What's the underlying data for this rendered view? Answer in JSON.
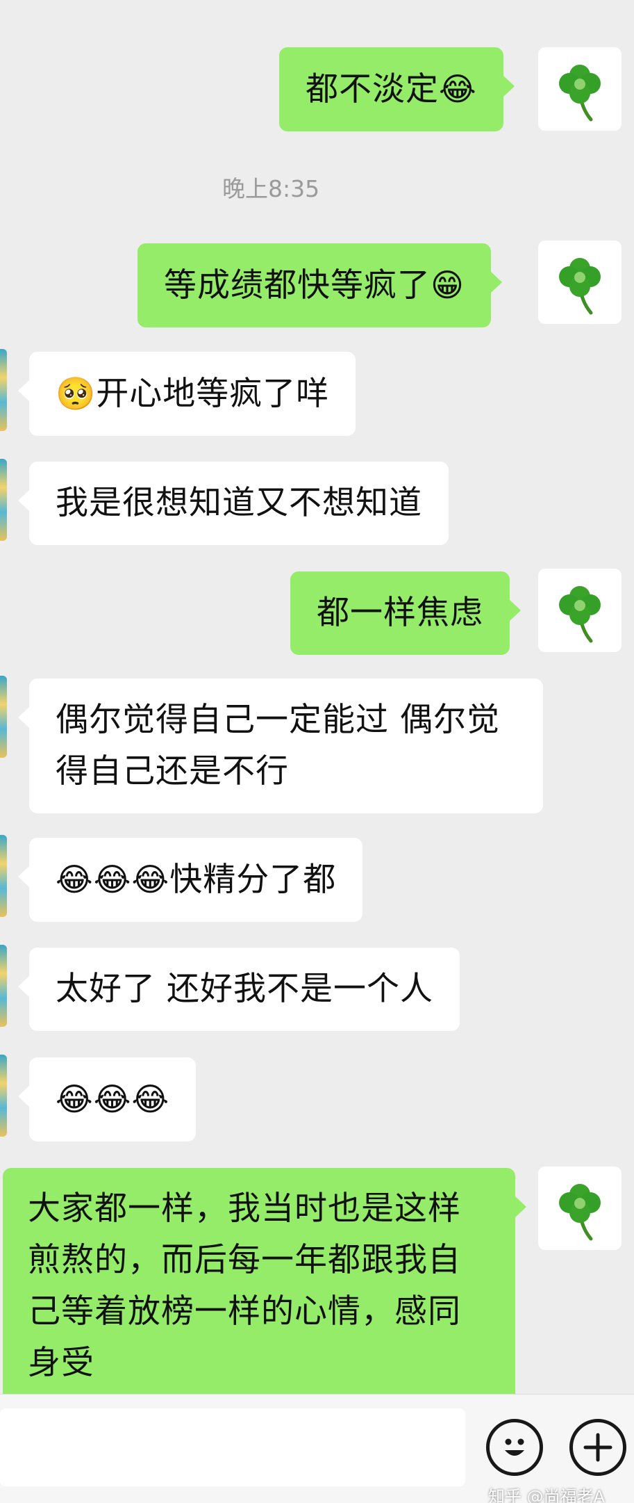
{
  "timestamp": "晚上8:35",
  "messages": [
    {
      "from": "me",
      "text": "都不淡定",
      "emoji": "😂"
    },
    {
      "from": "me",
      "text": "等成绩都快等疯了",
      "emoji": "😁"
    },
    {
      "from": "them",
      "text": "开心地等疯了咩",
      "emoji": "🥺"
    },
    {
      "from": "them",
      "text": "我是很想知道又不想知道"
    },
    {
      "from": "me",
      "text": "都一样焦虑"
    },
    {
      "from": "them",
      "line1": "偶尔觉得自己一定能过 偶尔觉",
      "line2": "得自己还是不行"
    },
    {
      "from": "them",
      "text": "快精分了都",
      "emoji": "😂😂😂"
    },
    {
      "from": "them",
      "text": "太好了 还好我不是一个人"
    },
    {
      "from": "them",
      "emoji": "😂😂😂"
    },
    {
      "from": "me",
      "line1": "大家都一样，我当时也是这样",
      "line2": "煎熬的，而后每一年都跟我自",
      "line3": "己等着放榜一样的心情，感同",
      "line4": "身受"
    }
  ],
  "avatar_icon": "four-leaf-clover-icon",
  "input": {
    "value": "",
    "placeholder": ""
  },
  "toolbar": {
    "emoji_icon": "smiley-icon",
    "more_icon": "plus-icon"
  },
  "watermark": "知乎 @尚福老A",
  "colors": {
    "background": "#ededed",
    "my_bubble": "#95ec69",
    "their_bubble": "#ffffff"
  }
}
